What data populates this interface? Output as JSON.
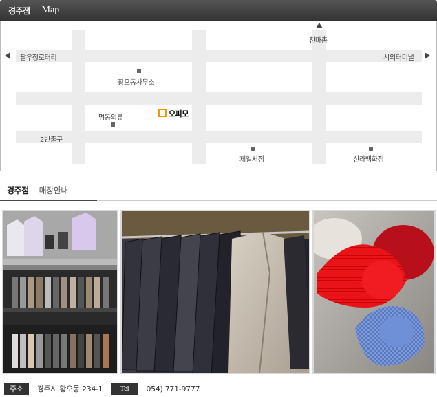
{
  "header": {
    "branch": "경주점",
    "map_label": "Map"
  },
  "map": {
    "labels": {
      "palujeong": "팔우정로터리",
      "terminal": "시외터미널",
      "cheonmachong": "천마총",
      "hwangodong_office": "황오동사무소",
      "myeongdong": "명동의류",
      "exit2": "2번출구",
      "jeil": "제일서점",
      "shilla": "신라백화점"
    },
    "store": {
      "name": "오피모",
      "marker_color": "#f39700"
    }
  },
  "tabs": {
    "active_branch": "경주점",
    "store_info": "매장안내"
  },
  "footer": {
    "address_label": "주소",
    "address": "경주시 황오동 234-1",
    "tel_label": "Tel",
    "tel": "054) 771-9777"
  }
}
